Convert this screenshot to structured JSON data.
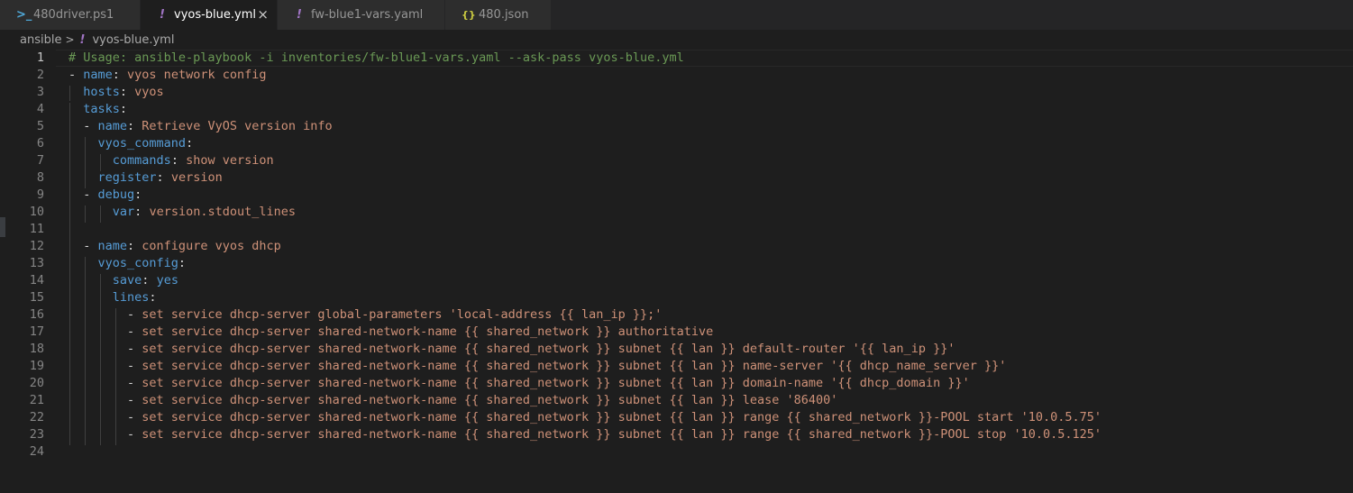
{
  "tabs": [
    {
      "label": "480driver.ps1",
      "icon": "powershell-icon",
      "glyph": ">_",
      "active": false
    },
    {
      "label": "vyos-blue.yml",
      "icon": "yaml-icon",
      "glyph": "!",
      "active": true,
      "close": "×"
    },
    {
      "label": "fw-blue1-vars.yaml",
      "icon": "yaml-icon",
      "glyph": "!",
      "active": false
    },
    {
      "label": "480.json",
      "icon": "json-icon",
      "glyph": "{}",
      "active": false
    }
  ],
  "breadcrumb": {
    "folder": "ansible",
    "separator": ">",
    "file_glyph": "!",
    "file": "vyos-blue.yml"
  },
  "colors": {
    "background": "#1e1e1e",
    "comment": "#6a9955",
    "key": "#569cd6",
    "string": "#ce9178",
    "punct": "#d4d4d4"
  },
  "editor": {
    "current_line": 1,
    "lines": [
      {
        "n": "1",
        "indent": 0,
        "parts": [
          [
            "c",
            "# Usage: ansible-playbook -i inventories/fw-blue1-vars.yaml --ask-pass vyos-blue.yml"
          ]
        ]
      },
      {
        "n": "2",
        "indent": 0,
        "parts": [
          [
            "p",
            "- "
          ],
          [
            "k",
            "name"
          ],
          [
            "p",
            ": "
          ],
          [
            "s",
            "vyos network config"
          ]
        ]
      },
      {
        "n": "3",
        "indent": 1,
        "parts": [
          [
            "p",
            "  "
          ],
          [
            "k",
            "hosts"
          ],
          [
            "p",
            ": "
          ],
          [
            "s",
            "vyos"
          ]
        ]
      },
      {
        "n": "4",
        "indent": 1,
        "parts": [
          [
            "p",
            "  "
          ],
          [
            "k",
            "tasks"
          ],
          [
            "p",
            ":"
          ]
        ]
      },
      {
        "n": "5",
        "indent": 1,
        "parts": [
          [
            "p",
            "  - "
          ],
          [
            "k",
            "name"
          ],
          [
            "p",
            ": "
          ],
          [
            "s",
            "Retrieve VyOS version info"
          ]
        ]
      },
      {
        "n": "6",
        "indent": 2,
        "parts": [
          [
            "p",
            "    "
          ],
          [
            "k",
            "vyos_command"
          ],
          [
            "p",
            ":"
          ]
        ]
      },
      {
        "n": "7",
        "indent": 3,
        "parts": [
          [
            "p",
            "      "
          ],
          [
            "k",
            "commands"
          ],
          [
            "p",
            ": "
          ],
          [
            "s",
            "show version"
          ]
        ]
      },
      {
        "n": "8",
        "indent": 2,
        "parts": [
          [
            "p",
            "    "
          ],
          [
            "k",
            "register"
          ],
          [
            "p",
            ": "
          ],
          [
            "s",
            "version"
          ]
        ]
      },
      {
        "n": "9",
        "indent": 1,
        "parts": [
          [
            "p",
            "  - "
          ],
          [
            "k",
            "debug"
          ],
          [
            "p",
            ":"
          ]
        ]
      },
      {
        "n": "10",
        "indent": 3,
        "parts": [
          [
            "p",
            "      "
          ],
          [
            "k",
            "var"
          ],
          [
            "p",
            ": "
          ],
          [
            "s",
            "version.stdout_lines"
          ]
        ]
      },
      {
        "n": "11",
        "indent": 1,
        "parts": []
      },
      {
        "n": "12",
        "indent": 1,
        "parts": [
          [
            "p",
            "  - "
          ],
          [
            "k",
            "name"
          ],
          [
            "p",
            ": "
          ],
          [
            "s",
            "configure vyos dhcp"
          ]
        ]
      },
      {
        "n": "13",
        "indent": 2,
        "parts": [
          [
            "p",
            "    "
          ],
          [
            "k",
            "vyos_config"
          ],
          [
            "p",
            ":"
          ]
        ]
      },
      {
        "n": "14",
        "indent": 3,
        "parts": [
          [
            "p",
            "      "
          ],
          [
            "k",
            "save"
          ],
          [
            "p",
            ": "
          ],
          [
            "k",
            "yes"
          ]
        ]
      },
      {
        "n": "15",
        "indent": 3,
        "parts": [
          [
            "p",
            "      "
          ],
          [
            "k",
            "lines"
          ],
          [
            "p",
            ":"
          ]
        ]
      },
      {
        "n": "16",
        "indent": 4,
        "parts": [
          [
            "p",
            "        - "
          ],
          [
            "s",
            "set service dhcp-server global-parameters 'local-address {{ lan_ip }};'"
          ]
        ]
      },
      {
        "n": "17",
        "indent": 4,
        "parts": [
          [
            "p",
            "        - "
          ],
          [
            "s",
            "set service dhcp-server shared-network-name {{ shared_network }} authoritative"
          ]
        ]
      },
      {
        "n": "18",
        "indent": 4,
        "parts": [
          [
            "p",
            "        - "
          ],
          [
            "s",
            "set service dhcp-server shared-network-name {{ shared_network }} subnet {{ lan }} default-router '{{ lan_ip }}'"
          ]
        ]
      },
      {
        "n": "19",
        "indent": 4,
        "parts": [
          [
            "p",
            "        - "
          ],
          [
            "s",
            "set service dhcp-server shared-network-name {{ shared_network }} subnet {{ lan }} name-server '{{ dhcp_name_server }}'"
          ]
        ]
      },
      {
        "n": "20",
        "indent": 4,
        "parts": [
          [
            "p",
            "        - "
          ],
          [
            "s",
            "set service dhcp-server shared-network-name {{ shared_network }} subnet {{ lan }} domain-name '{{ dhcp_domain }}'"
          ]
        ]
      },
      {
        "n": "21",
        "indent": 4,
        "parts": [
          [
            "p",
            "        - "
          ],
          [
            "s",
            "set service dhcp-server shared-network-name {{ shared_network }} subnet {{ lan }} lease '86400'"
          ]
        ]
      },
      {
        "n": "22",
        "indent": 4,
        "parts": [
          [
            "p",
            "        - "
          ],
          [
            "s",
            "set service dhcp-server shared-network-name {{ shared_network }} subnet {{ lan }} range {{ shared_network }}-POOL start '10.0.5.75'"
          ]
        ]
      },
      {
        "n": "23",
        "indent": 4,
        "parts": [
          [
            "p",
            "        - "
          ],
          [
            "s",
            "set service dhcp-server shared-network-name {{ shared_network }} subnet {{ lan }} range {{ shared_network }}-POOL stop '10.0.5.125'"
          ]
        ]
      },
      {
        "n": "24",
        "indent": 0,
        "parts": []
      }
    ]
  }
}
